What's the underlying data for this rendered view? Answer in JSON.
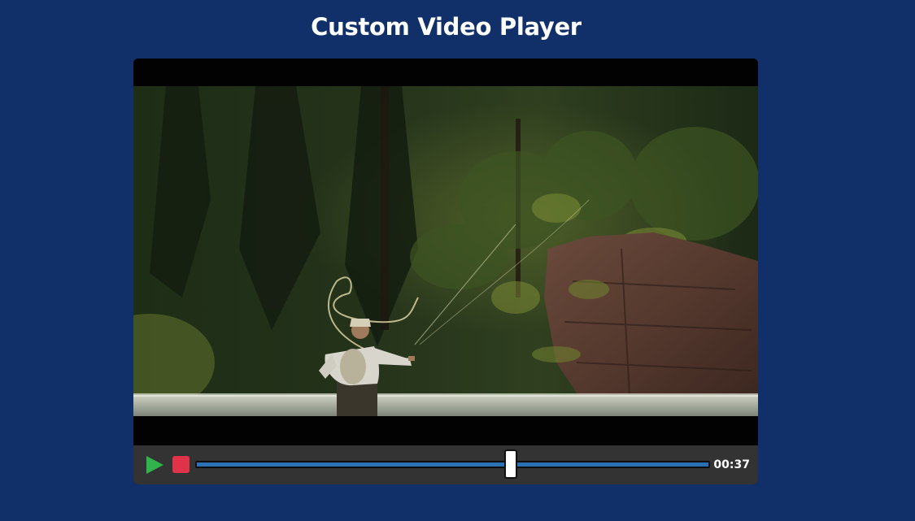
{
  "page": {
    "title": "Custom Video Player"
  },
  "player": {
    "controls": {
      "play_icon": "play-icon",
      "stop_icon": "stop-icon",
      "time": "00:37",
      "progress_fraction": 0.613
    },
    "colors": {
      "background": "#11306a",
      "play": "#2fb34a",
      "stop": "#e0334a",
      "seek": "#2d72b4",
      "controls_bar": "#333333"
    }
  }
}
